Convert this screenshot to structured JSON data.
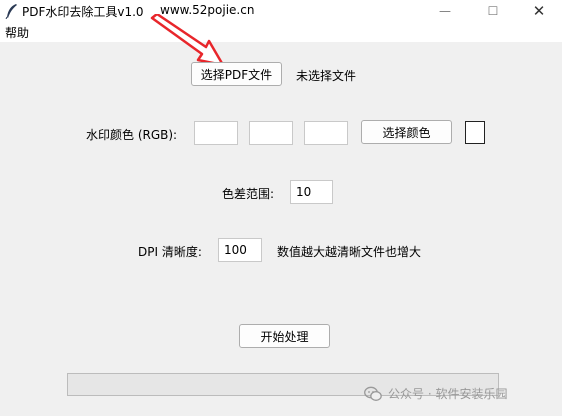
{
  "window": {
    "title": "PDF水印去除工具v1.0",
    "url_annotation": "www.52pojie.cn",
    "minimize_glyph": "—",
    "maximize_glyph": "☐",
    "close_glyph": "✕"
  },
  "menu": {
    "help_label": "帮助"
  },
  "file_row": {
    "select_button": "选择PDF文件",
    "status": "未选择文件"
  },
  "color_row": {
    "label": "水印颜色 (RGB):",
    "r_value": "",
    "g_value": "",
    "b_value": "",
    "pick_button": "选择颜色",
    "swatch_color": "#ffffff"
  },
  "tolerance_row": {
    "label": "色差范围:",
    "value": "10"
  },
  "dpi_row": {
    "label": "DPI 清晰度:",
    "value": "100",
    "hint": "数值越大越清晰文件也增大"
  },
  "actions": {
    "start_button": "开始处理"
  },
  "progress": {
    "value": 0
  },
  "watermark": {
    "text": "公众号 · 软件安装乐园"
  },
  "colors": {
    "arrow": "#e8262b",
    "background": "#f0f0f0"
  },
  "icons": {
    "app": "feather-icon",
    "watermark": "wechat-icon"
  }
}
